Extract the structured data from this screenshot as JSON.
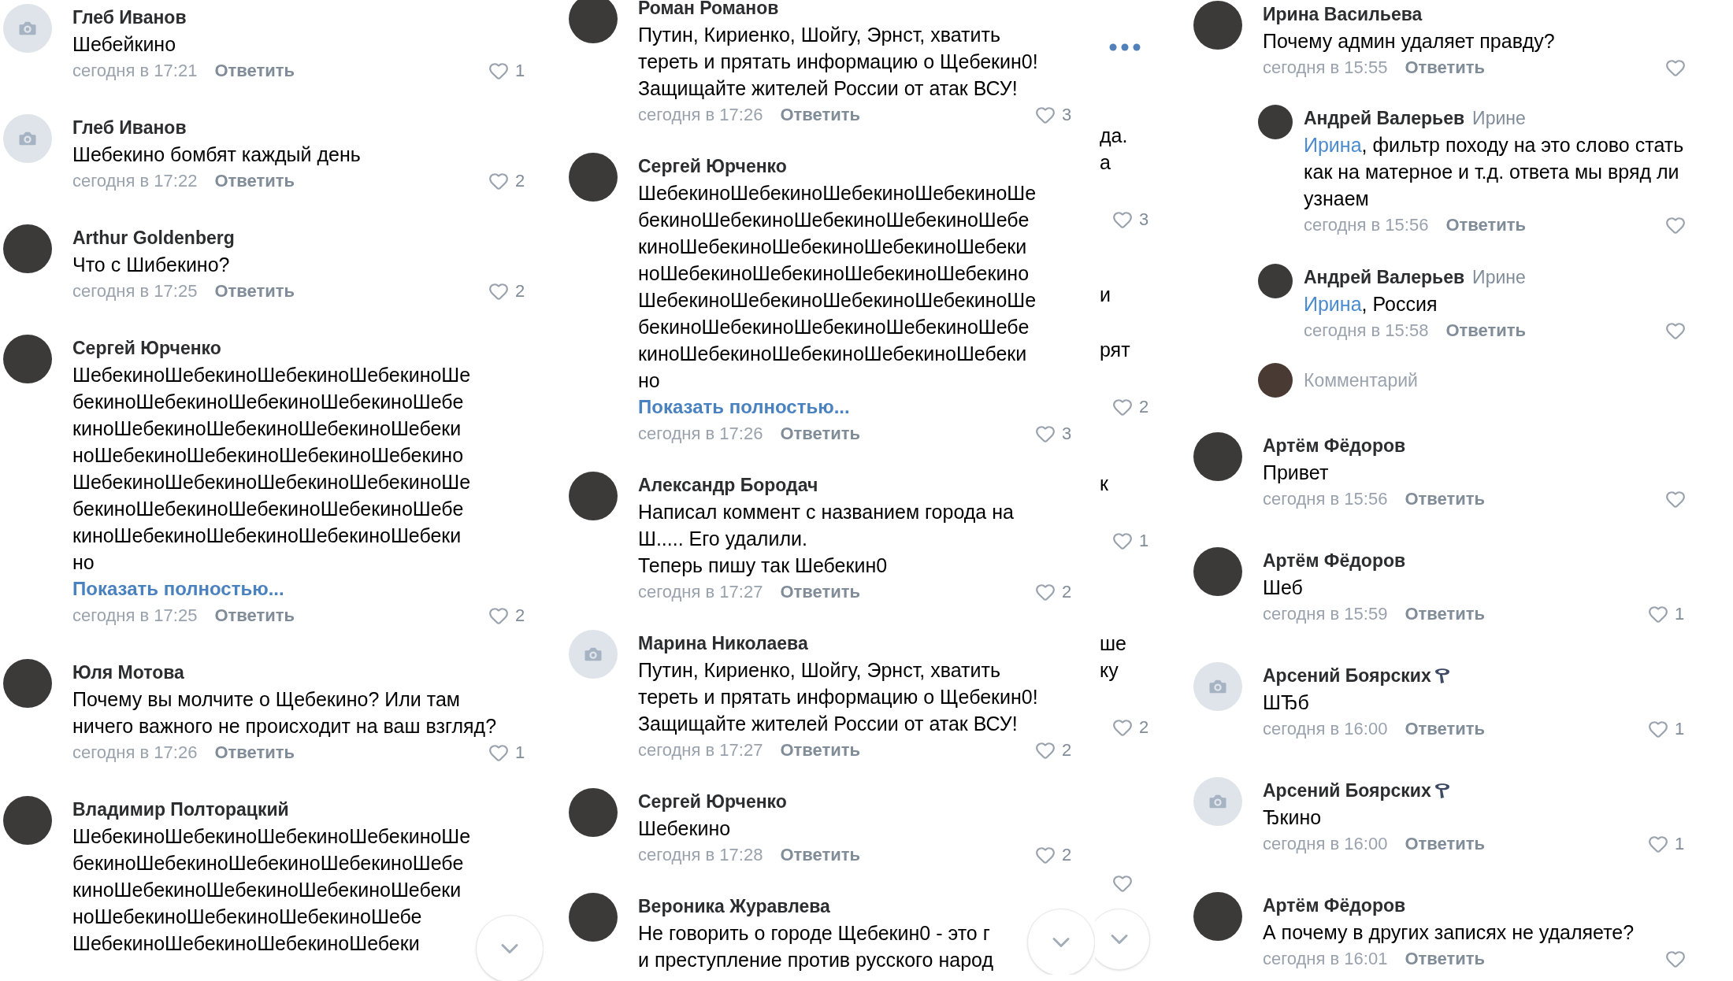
{
  "columns": [
    {
      "scroll_down": true,
      "comments": [
        {
          "kind": "camera",
          "author": "Глеб Иванов",
          "text": "Шебейкино",
          "time": "сегодня в 17:21",
          "reply_label": "Ответить",
          "likes": "1"
        },
        {
          "kind": "camera",
          "author": "Глеб Иванов",
          "text": "Шебекино бомбят каждый день",
          "time": "сегодня в 17:22",
          "reply_label": "Ответить",
          "likes": "2"
        },
        {
          "kind": "photo",
          "author": "Arthur Goldenberg",
          "text": "Что с Шибекино?",
          "time": "сегодня в 17:25",
          "reply_label": "Ответить",
          "likes": "2"
        },
        {
          "kind": "photo",
          "author": "Сергей Юрченко",
          "text": "ШебекиноШебекиноШебекиноШебекиноШе\nбекиноШебекиноШебекиноШебекиноШебе\nкиноШебекиноШебекиноШебекиноШебеки\nноШебекиноШебекиноШебекиноШебекино\nШебекиноШебекиноШебекиноШебекиноШе\nбекиноШебекиноШебекиноШебекиноШебе\nкиноШебекиноШебекиноШебекиноШебеки\nно",
          "show_more": "Показать полностью...",
          "time": "сегодня в 17:25",
          "reply_label": "Ответить",
          "likes": "2"
        },
        {
          "kind": "photo",
          "author": "Юля Мотова",
          "text": "Почему вы молчите о Щебекино? Или там ничего важного не происходит на ваш взгляд?",
          "time": "сегодня в 17:26",
          "reply_label": "Ответить",
          "likes": "1"
        },
        {
          "kind": "photo",
          "author": "Владимир Полторацкий",
          "text": "ШебекиноШебекиноШебекиноШебекиноШе\nбекиноШебекиноШебекиноШебекиноШебе\nкиноШебекиноШебекиноШебекиноШебеки\nноШебекиноШебекиноШебекиноШебе\nШебекиноШебекиноШебекиноШебеки"
        }
      ]
    },
    {
      "scroll_down": true,
      "comments": [
        {
          "kind": "photo",
          "author": "Роман Романов",
          "text": "Путин, Кириенко, Шойгу, Эрнст, хватить\nтереть и прятать информацию о Щебекин0!\nЗащищайте жителей России от атак ВСУ!",
          "time": "сегодня в 17:26",
          "reply_label": "Ответить",
          "likes": "3"
        },
        {
          "kind": "photo",
          "author": "Сергей Юрченко",
          "text": "ШебекиноШебекиноШебекиноШебекиноШе\nбекиноШебекиноШебекиноШебекиноШебе\nкиноШебекиноШебекиноШебекиноШебеки\nноШебекиноШебекиноШебекиноШебекино\nШебекиноШебекиноШебекиноШебекиноШе\nбекиноШебекиноШебекиноШебекиноШебе\nкиноШебекиноШебекиноШебекиноШебеки\nно",
          "show_more": "Показать полностью...",
          "time": "сегодня в 17:26",
          "reply_label": "Ответить",
          "likes": "3"
        },
        {
          "kind": "photo",
          "author": "Александр Бородач",
          "text": "Написал коммент с названием города на\nШ..... Его удалили.\nТеперь пишу так Шебекин0",
          "time": "сегодня в 17:27",
          "reply_label": "Ответить",
          "likes": "2"
        },
        {
          "kind": "camera",
          "author": "Марина Николаева",
          "text": "Путин, Кириенко, Шойгу, Эрнст, хватить\nтереть и прятать информацию о Щебекин0!\nЗащищайте жителей России от атак ВСУ!",
          "time": "сегодня в 17:27",
          "reply_label": "Ответить",
          "likes": "2"
        },
        {
          "kind": "photo",
          "author": "Сергей Юрченко",
          "text": "Шебекино",
          "time": "сегодня в 17:28",
          "reply_label": "Ответить",
          "likes": "2"
        },
        {
          "kind": "photo",
          "author": "Вероника Журавлева",
          "text": "Не говорить о городе Щебекин0 - это г\nи преступление против русского народ"
        }
      ]
    },
    {
      "scroll_down": false,
      "comments": [
        {
          "kind": "photo",
          "author": "Ирина Васильева",
          "text": "Почему админ удаляет правду?",
          "time": "сегодня в 15:55",
          "reply_label": "Ответить",
          "replies": [
            {
              "kind": "photo",
              "author": "Андрей Валерьев",
              "reply_to": "Ирине",
              "mention": "Ирина",
              "text": ", фильтр походу на это слово стать как на матерное и т.д. ответа мы вряд ли узнаем",
              "time": "сегодня в 15:56",
              "reply_label": "Ответить"
            },
            {
              "kind": "photo",
              "author": "Андрей Валерьев",
              "reply_to": "Ирине",
              "mention": "Ирина",
              "text": ", Россия",
              "time": "сегодня в 15:58",
              "reply_label": "Ответить"
            }
          ],
          "composer": {
            "placeholder": "Комментарий"
          }
        },
        {
          "kind": "photo",
          "author": "Артём Фёдоров",
          "text": "Привет",
          "time": "сегодня в 15:56",
          "reply_label": "Ответить"
        },
        {
          "kind": "photo",
          "author": "Артём Фёдоров",
          "text": "Шеб",
          "time": "сегодня в 15:59",
          "reply_label": "Ответить",
          "likes": "1"
        },
        {
          "kind": "camera",
          "author": "Арсений Боярских",
          "badge": true,
          "text": "ШЂб",
          "time": "сегодня в 16:00",
          "reply_label": "Ответить",
          "likes": "1"
        },
        {
          "kind": "camera",
          "author": "Арсений Боярских",
          "badge": true,
          "text": "Ђкино",
          "time": "сегодня в 16:00",
          "reply_label": "Ответить",
          "likes": "1"
        },
        {
          "kind": "photo",
          "author": "Артём Фёдоров",
          "text": "А почему в других записях не удаляете?",
          "time": "сегодня в 16:01",
          "reply_label": "Ответить"
        }
      ]
    }
  ],
  "side_strip": [
    {
      "kind": "more"
    },
    {
      "kind": "text",
      "text": "да."
    },
    {
      "kind": "text",
      "text": "а"
    },
    {
      "kind": "like",
      "count": "3"
    },
    {
      "kind": "text",
      "text": "и"
    },
    {
      "kind": "text",
      "text": "рят"
    },
    {
      "kind": "like",
      "count": "2"
    },
    {
      "kind": "text",
      "text": "к"
    },
    {
      "kind": "like",
      "count": "1"
    },
    {
      "kind": "text",
      "text": "ше"
    },
    {
      "kind": "text",
      "text": "ку"
    },
    {
      "kind": "like",
      "count": "2"
    },
    {
      "kind": "like"
    },
    {
      "kind": "scroll"
    }
  ]
}
